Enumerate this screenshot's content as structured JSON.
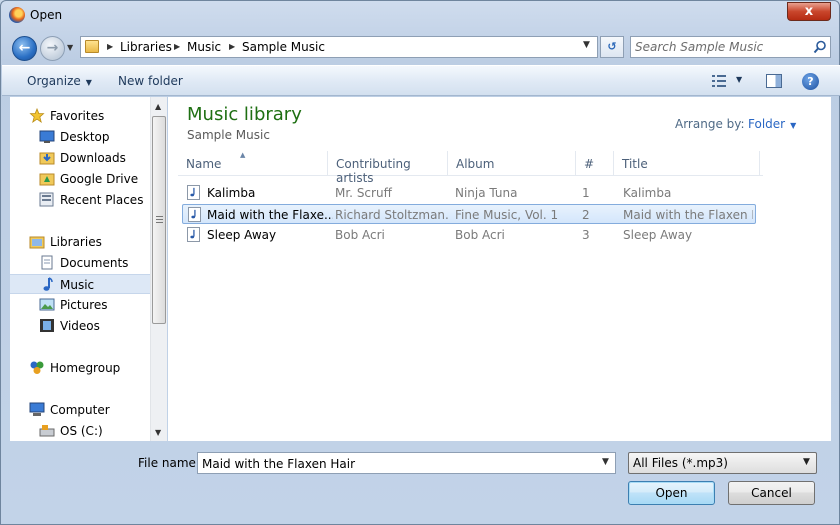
{
  "window": {
    "title": "Open",
    "close_label": "x"
  },
  "address": {
    "crumbs": [
      "Libraries",
      "Music",
      "Sample Music"
    ],
    "refresh_glyph": "↺"
  },
  "search": {
    "placeholder": "Search Sample Music"
  },
  "toolbar": {
    "organize": "Organize",
    "new_folder": "New folder",
    "help": "?"
  },
  "nav": {
    "items": [
      {
        "label": "Favorites",
        "icon": "star-icon"
      },
      {
        "label": "Desktop",
        "icon": "desktop-icon"
      },
      {
        "label": "Downloads",
        "icon": "downloads-folder-icon"
      },
      {
        "label": "Google Drive",
        "icon": "google-drive-folder-icon"
      },
      {
        "label": "Recent Places",
        "icon": "recent-places-icon"
      },
      {
        "label": "Libraries",
        "icon": "libraries-icon"
      },
      {
        "label": "Documents",
        "icon": "documents-icon"
      },
      {
        "label": "Music",
        "icon": "music-note-icon",
        "selected": true
      },
      {
        "label": "Pictures",
        "icon": "pictures-icon"
      },
      {
        "label": "Videos",
        "icon": "videos-icon"
      },
      {
        "label": "Homegroup",
        "icon": "homegroup-icon"
      },
      {
        "label": "Computer",
        "icon": "computer-icon"
      },
      {
        "label": "OS (C:)",
        "icon": "drive-icon"
      }
    ]
  },
  "library": {
    "title": "Music library",
    "subtitle": "Sample Music",
    "arrange_label": "Arrange by:",
    "arrange_value": "Folder"
  },
  "columns": [
    "Name",
    "Contributing artists",
    "Album",
    "#",
    "Title"
  ],
  "rows": [
    {
      "name": "Kalimba",
      "artist": "Mr. Scruff",
      "album": "Ninja Tuna",
      "num": "1",
      "title": "Kalimba"
    },
    {
      "name": "Maid with the Flaxe...",
      "artist": "Richard Stoltzman...",
      "album": "Fine Music, Vol. 1",
      "num": "2",
      "title": "Maid with the Flaxen H...",
      "selected": true
    },
    {
      "name": "Sleep Away",
      "artist": "Bob Acri",
      "album": "Bob Acri",
      "num": "3",
      "title": "Sleep Away"
    }
  ],
  "footer": {
    "file_name_label": "File name:",
    "file_name_value": "Maid with the Flaxen Hair",
    "filter_value": "All Files (*.mp3)",
    "open_label": "Open",
    "cancel_label": "Cancel"
  }
}
